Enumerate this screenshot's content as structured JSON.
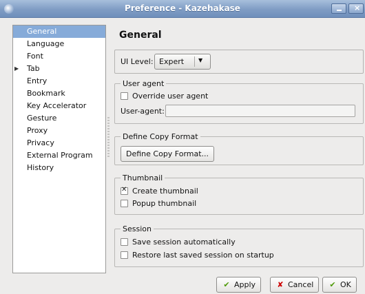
{
  "window": {
    "title": "Preference - Kazehakase"
  },
  "sidebar": {
    "items": [
      {
        "label": "General",
        "selected": true,
        "expandable": false
      },
      {
        "label": "Language",
        "selected": false,
        "expandable": false
      },
      {
        "label": "Font",
        "selected": false,
        "expandable": false
      },
      {
        "label": "Tab",
        "selected": false,
        "expandable": true
      },
      {
        "label": "Entry",
        "selected": false,
        "expandable": false
      },
      {
        "label": "Bookmark",
        "selected": false,
        "expandable": false
      },
      {
        "label": "Key Accelerator",
        "selected": false,
        "expandable": false
      },
      {
        "label": "Gesture",
        "selected": false,
        "expandable": false
      },
      {
        "label": "Proxy",
        "selected": false,
        "expandable": false
      },
      {
        "label": "Privacy",
        "selected": false,
        "expandable": false
      },
      {
        "label": "External Program",
        "selected": false,
        "expandable": false
      },
      {
        "label": "History",
        "selected": false,
        "expandable": false
      }
    ]
  },
  "page": {
    "title": "General"
  },
  "ui_level": {
    "label": "UI Level:",
    "value": "Expert"
  },
  "user_agent": {
    "legend": "User agent",
    "override_label": "Override user agent",
    "override_checked": false,
    "field_label": "User-agent:",
    "field_value": ""
  },
  "copy_format": {
    "legend": "Define Copy Format",
    "button_label": "Define Copy Format..."
  },
  "thumbnail": {
    "legend": "Thumbnail",
    "create_label": "Create thumbnail",
    "create_checked": true,
    "popup_label": "Popup thumbnail",
    "popup_checked": false
  },
  "session": {
    "legend": "Session",
    "save_label": "Save session automatically",
    "save_checked": false,
    "restore_label": "Restore last saved session on startup",
    "restore_checked": false
  },
  "buttons": {
    "apply": "Apply",
    "cancel": "Cancel",
    "ok": "OK"
  },
  "icons": {
    "apply": "check-icon",
    "cancel": "cross-icon",
    "ok": "check-icon"
  },
  "colors": {
    "selection": "#86abd9",
    "titlebar": "#7f9cc4",
    "apply_check": "#4e9a06",
    "cancel_cross": "#cc0000"
  }
}
